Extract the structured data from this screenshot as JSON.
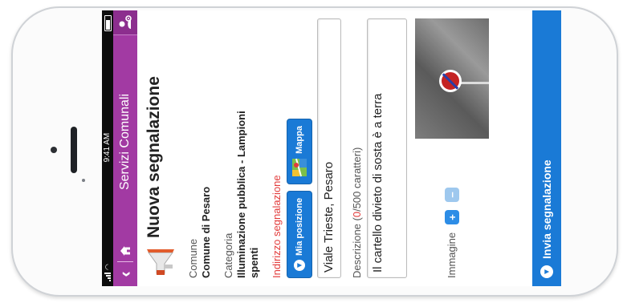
{
  "status_bar": {
    "time": "9:41 AM"
  },
  "nav": {
    "title": "Servizi Comunali",
    "back_glyph": "‹",
    "home_icon": "home-icon",
    "user_icon": "user-settings-icon"
  },
  "page": {
    "title": "Nuova segnalazione"
  },
  "form": {
    "comune_label": "Comune",
    "comune_value": "Comune di Pesaro",
    "categoria_label": "Categoria",
    "categoria_value": "Illuminazione pubblica - Lampioni spenti",
    "indirizzo_label": "Indirizzo segnalazione",
    "btn_mia_posizione": "Mia posizione",
    "btn_mappa": "Mappa",
    "indirizzo_value": "Viale Trieste, Pesaro",
    "descrizione_label": "Descrizione (",
    "descrizione_count": "0",
    "descrizione_suffix": "/500 caratteri)",
    "descrizione_value": "Il cartello divieto di sosta è a terra",
    "immagine_label": "Immagine",
    "add_glyph": "+",
    "remove_glyph": "−"
  },
  "submit": {
    "label": "Invia segnalazione"
  },
  "colors": {
    "header": "#a23aa3",
    "accent": "#1a7ad6",
    "warning_text": "#e23b3b"
  }
}
